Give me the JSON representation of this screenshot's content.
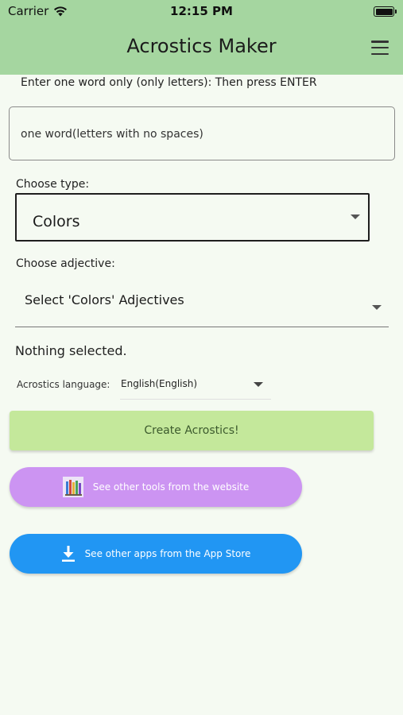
{
  "status_bar": {
    "carrier": "Carrier",
    "time": "12:15 PM",
    "wifi_icon": "wifi-icon",
    "battery_icon": "battery-icon"
  },
  "app_bar": {
    "title": "Acrostics Maker",
    "menu_icon": "hamburger-menu-icon",
    "color": "#a5d6a0"
  },
  "form": {
    "instruction": "Enter one word only (only letters): Then press ENTER",
    "word_placeholder": "one word(letters with no spaces)",
    "type_label": "Choose type:",
    "type_value": "Colors",
    "adjective_label": "Choose adjective:",
    "adjective_value": "Select 'Colors' Adjectives",
    "selection_status": "Nothing selected.",
    "language_label": "Acrostics language:",
    "language_value": "English(English)"
  },
  "buttons": {
    "create_label": "Create Acrostics!",
    "create_color": "#c4e89b",
    "website_label": "See other tools from the website",
    "website_color": "#cc94f2",
    "website_icon": "books-icon",
    "appstore_label": "See other apps from the App Store",
    "appstore_color": "#2196f3",
    "appstore_icon": "download-icon"
  }
}
